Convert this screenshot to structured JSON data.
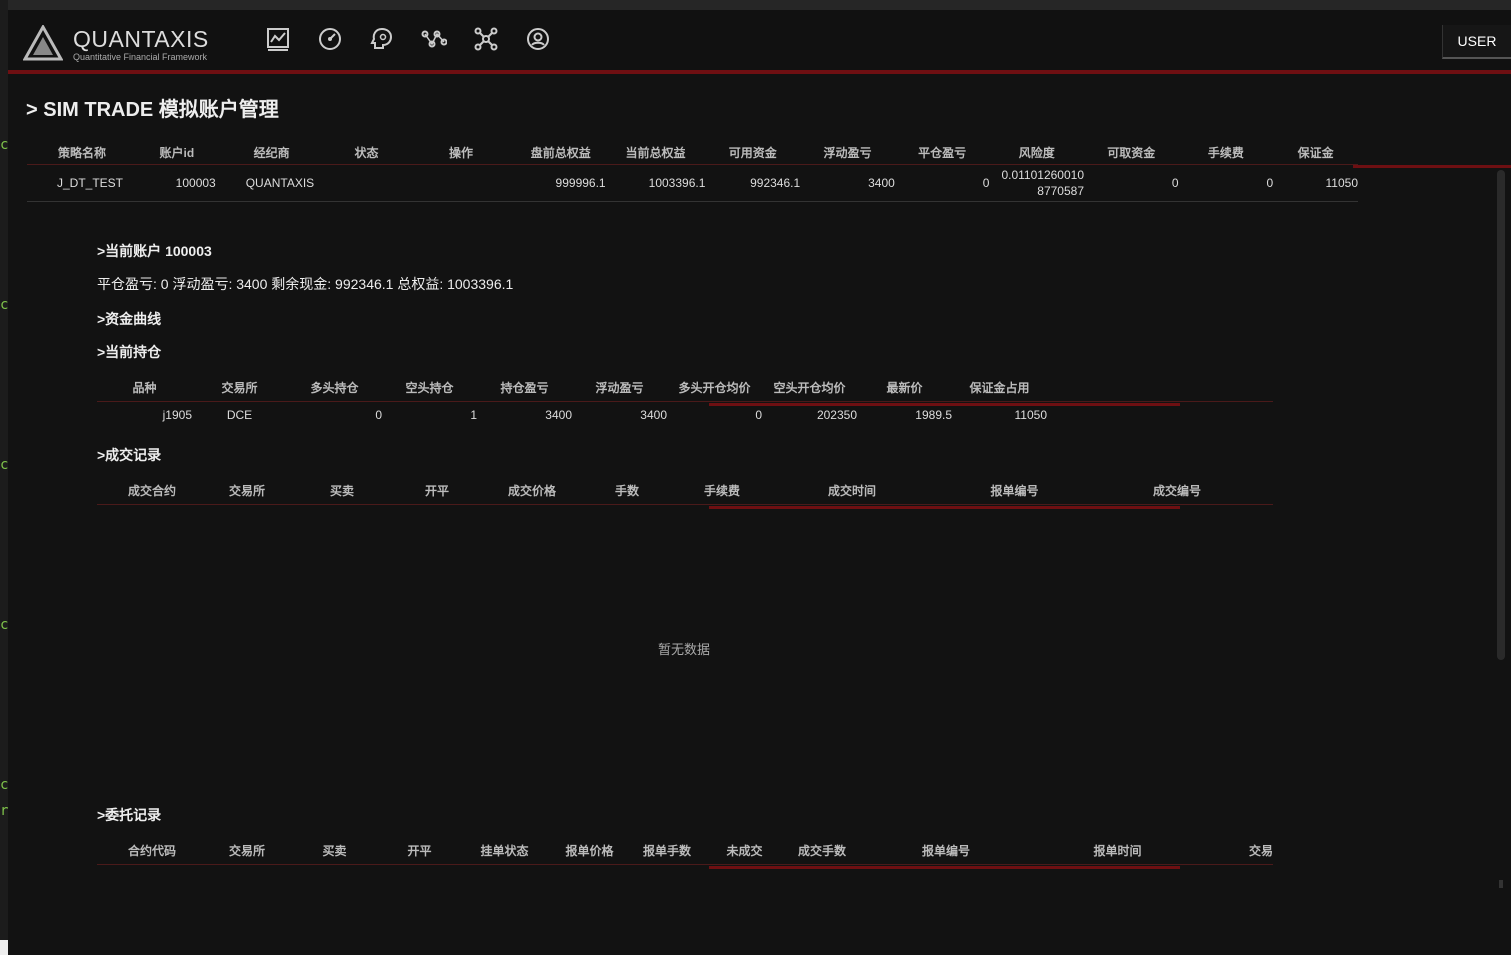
{
  "app": {
    "logo_title": "QUANTAXIS",
    "logo_subtitle": "Quantitative Financial Framework",
    "user_button": "USER"
  },
  "nav_icons": [
    "chart-icon",
    "dashboard-icon",
    "brain-icon",
    "network-icon",
    "hub-icon",
    "account-circle-icon"
  ],
  "page_title": "> SIM TRADE 模拟账户管理",
  "account_table": {
    "columns": [
      "策略名称",
      "账户id",
      "经纪商",
      "状态",
      "操作",
      "盘前总权益",
      "当前总权益",
      "可用资金",
      "浮动盈亏",
      "平仓盈亏",
      "风险度",
      "可取资金",
      "手续费",
      "保证金"
    ],
    "rows": [
      [
        "J_DT_TEST",
        "100003",
        "QUANTAXIS",
        "",
        "",
        "999996.1",
        "1003396.1",
        "992346.1",
        "3400",
        "0",
        "0.011012600108770587",
        "0",
        "0",
        "11050"
      ]
    ]
  },
  "current_account": {
    "heading": ">当前账户 100003",
    "summary": "平仓盈亏: 0 浮动盈亏: 3400 剩余现金: 992346.1 总权益: 1003396.1"
  },
  "equity_curve_heading": ">资金曲线",
  "positions": {
    "heading": ">当前持仓",
    "columns": [
      "品种",
      "交易所",
      "多头持仓",
      "空头持仓",
      "持仓盈亏",
      "浮动盈亏",
      "多头开仓均价",
      "空头开仓均价",
      "最新价",
      "保证金占用"
    ],
    "rows": [
      [
        "j1905",
        "DCE",
        "0",
        "1",
        "3400",
        "3400",
        "0",
        "202350",
        "1989.5",
        "11050"
      ]
    ]
  },
  "trades": {
    "heading": ">成交记录",
    "columns": [
      "成交合约",
      "交易所",
      "买卖",
      "开平",
      "成交价格",
      "手数",
      "手续费",
      "成交时间",
      "报单编号",
      "成交编号"
    ],
    "empty_text": "暂无数据"
  },
  "orders": {
    "heading": ">委托记录",
    "columns": [
      "合约代码",
      "交易所",
      "买卖",
      "开平",
      "挂单状态",
      "报单价格",
      "报单手数",
      "未成交",
      "成交手数",
      "报单编号",
      "报单时间",
      "交易"
    ]
  },
  "colors": {
    "background": "#121212",
    "accent_red": "#6e0f12"
  }
}
